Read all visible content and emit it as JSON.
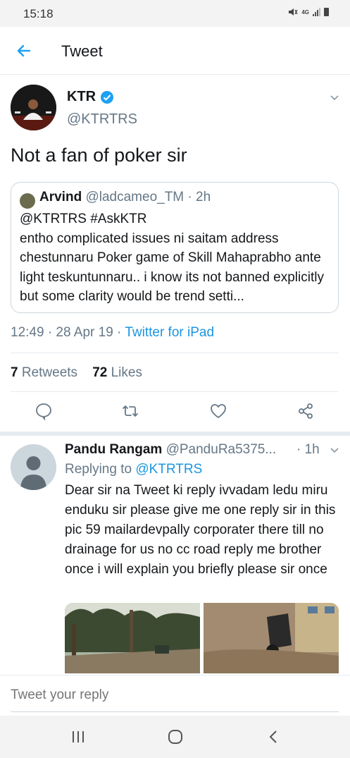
{
  "status_bar": {
    "time": "15:18",
    "network": "4G"
  },
  "header": {
    "title": "Tweet"
  },
  "tweet": {
    "author_name": "KTR",
    "author_handle": "@KTRTRS",
    "text": "Not a fan of poker sir",
    "timestamp": "12:49 · 28 Apr 19 · ",
    "source": "Twitter for iPad",
    "retweets_count": "7",
    "retweets_label": " Retweets",
    "likes_count": "72",
    "likes_label": " Likes"
  },
  "quoted_tweet": {
    "author_name": "Arvind",
    "author_handle": " @ladcameo_TM · 2h",
    "text": "@KTRTRS #AskKTR\nentho complicated issues ni saitam address chestunnaru Poker game of Skill Mahaprabho ante light teskuntunnaru.. i know its not banned explicitly but some clarity would be trend setti..."
  },
  "reply": {
    "author_name": "Pandu Rangam",
    "author_handle": " @PanduRa5375...",
    "time": "· 1h",
    "replying_prefix": "Replying to ",
    "replying_to": "@KTRTRS",
    "text": "Dear sir na Tweet ki reply ivvadam ledu miru enduku sir please give me one reply sir in this pic 59 mailardevpally corporater there till no drainage for us no cc road reply me brother once i will explain you briefly please sir once"
  },
  "reply_bar": {
    "placeholder": "Tweet your reply"
  },
  "colors": {
    "accent": "#1b95e0",
    "secondary_text": "#657786",
    "verified": "#1da1f2"
  }
}
